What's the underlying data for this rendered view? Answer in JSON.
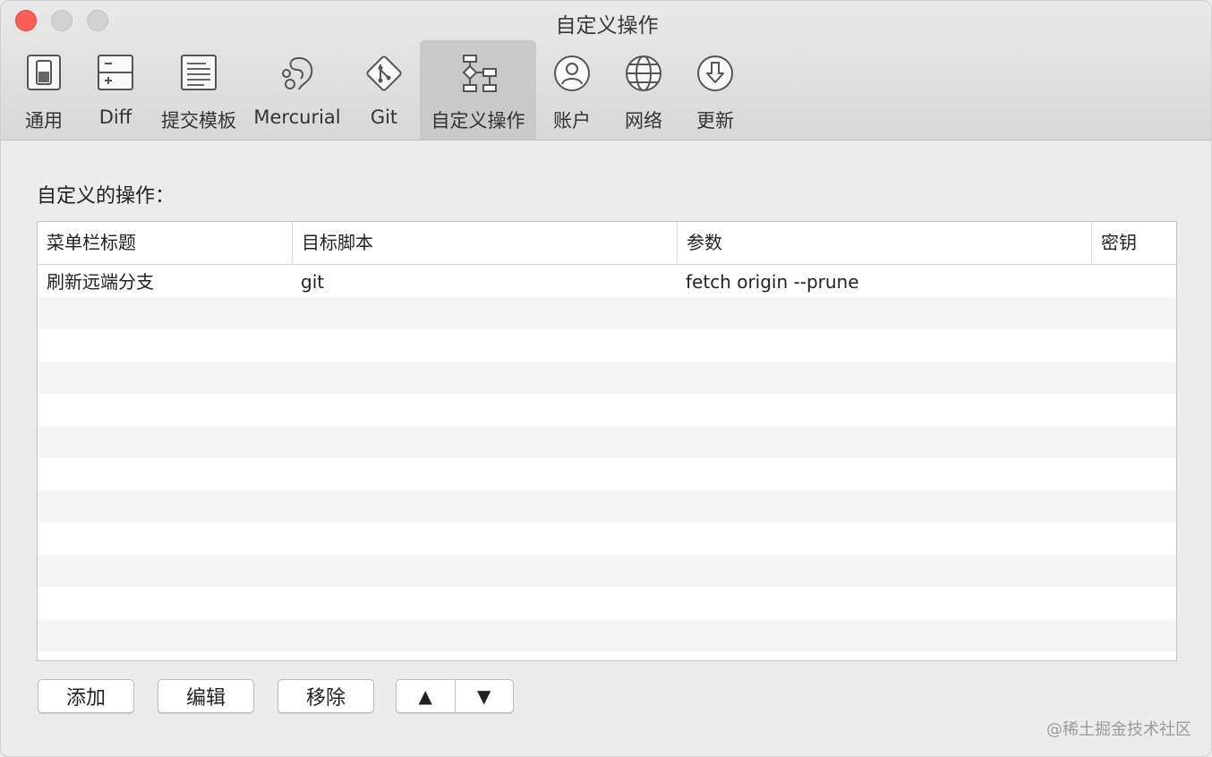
{
  "window": {
    "title": "自定义操作"
  },
  "toolbar": {
    "items": [
      {
        "label": "通用",
        "icon": "switch-icon"
      },
      {
        "label": "Diff",
        "icon": "diff-icon"
      },
      {
        "label": "提交模板",
        "icon": "document-icon"
      },
      {
        "label": "Mercurial",
        "icon": "mercurial-icon"
      },
      {
        "label": "Git",
        "icon": "git-icon"
      },
      {
        "label": "自定义操作",
        "icon": "flowchart-icon",
        "selected": true
      },
      {
        "label": "账户",
        "icon": "user-icon"
      },
      {
        "label": "网络",
        "icon": "globe-icon"
      },
      {
        "label": "更新",
        "icon": "download-icon"
      }
    ]
  },
  "main": {
    "section_label": "自定义的操作：",
    "table": {
      "columns": [
        "菜单栏标题",
        "目标脚本",
        "参数",
        "密钥"
      ],
      "rows": [
        [
          "刷新远端分支",
          "git",
          "fetch origin --prune",
          ""
        ]
      ]
    },
    "buttons": {
      "add": "添加",
      "edit": "编辑",
      "remove": "移除",
      "up": "▲",
      "down": "▼"
    }
  },
  "watermark": "@稀土掘金技术社区",
  "colors": {
    "close": "#fc5f57",
    "selected_tab": "#c9c9c9",
    "row_alt": "#f4f4f4"
  }
}
